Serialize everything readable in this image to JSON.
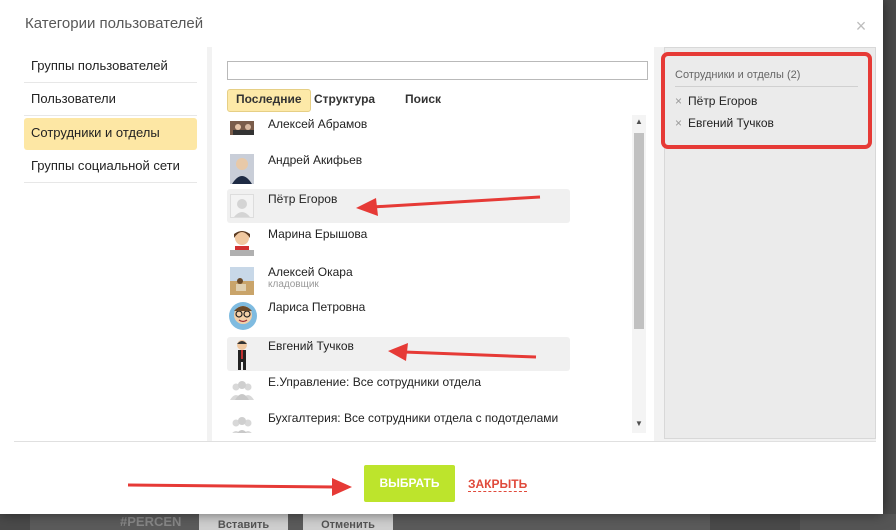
{
  "dialog": {
    "title": "Категории пользователей",
    "close_glyph": "×"
  },
  "categories": [
    {
      "label": "Группы пользователей",
      "active": false
    },
    {
      "label": "Пользователи",
      "active": false
    },
    {
      "label": "Сотрудники и отделы",
      "active": true
    },
    {
      "label": "Группы социальной сети",
      "active": false
    }
  ],
  "search": {
    "value": "",
    "placeholder": ""
  },
  "tabs": [
    {
      "label": "Последние",
      "active": true
    },
    {
      "label": "Структура",
      "active": false
    },
    {
      "label": "Поиск",
      "active": false
    }
  ],
  "users": [
    {
      "name": "Алексей Абрамов",
      "subtitle": "",
      "selected": false,
      "avatar": "photo-avatar"
    },
    {
      "name": "Андрей Акифьев",
      "subtitle": "",
      "selected": false,
      "avatar": "photo-avatar"
    },
    {
      "name": "Пётр Егоров",
      "subtitle": "",
      "selected": true,
      "avatar": "blank-avatar"
    },
    {
      "name": "Марина Ерышова",
      "subtitle": "",
      "selected": false,
      "avatar": "cartoon-avatar"
    },
    {
      "name": "Алексей Окара",
      "subtitle": "кладовщик",
      "selected": false,
      "avatar": "photo-avatar"
    },
    {
      "name": "Лариса Петровна",
      "subtitle": "",
      "selected": false,
      "avatar": "cartoon-avatar"
    },
    {
      "name": "Евгений Тучков",
      "subtitle": "",
      "selected": true,
      "avatar": "cartoon-avatar"
    },
    {
      "name": "Е.Управление: Все сотрудники отдела",
      "subtitle": "",
      "selected": false,
      "avatar": "group-icon"
    },
    {
      "name": "Бухгалтерия: Все сотрудники отдела с подотделами",
      "subtitle": "",
      "selected": false,
      "avatar": "group-icon"
    }
  ],
  "selected_panel": {
    "header": "Сотрудники и отделы (2)",
    "items": [
      {
        "label": "Пётр Егоров"
      },
      {
        "label": "Евгений Тучков"
      }
    ],
    "remove_glyph": "×"
  },
  "buttons": {
    "select_label": "ВЫБРАТЬ",
    "close_label": "ЗАКРЫТЬ"
  },
  "background": {
    "tag_text": "#PERCEN",
    "btn1_label": "Вставить",
    "btn2_label": "Отменить"
  },
  "colors": {
    "accent_active": "#fde7a4",
    "select_button": "#bde42c",
    "close_link": "#e04a3b",
    "annotation_red": "#e63a36"
  },
  "icons": {
    "scroll_up": "▲",
    "scroll_down": "▼"
  }
}
